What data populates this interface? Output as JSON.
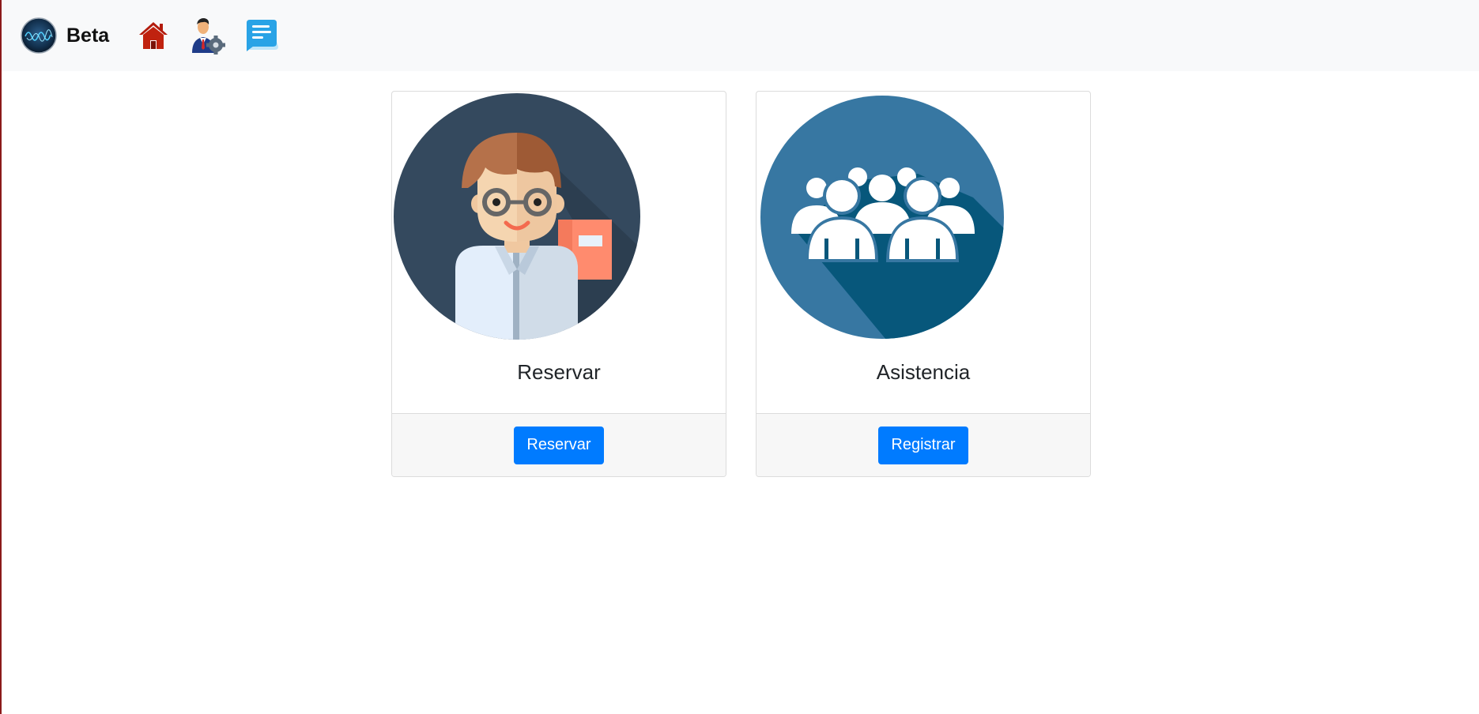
{
  "navbar": {
    "brand_name": "Beta",
    "icons": [
      "wave-logo-icon",
      "home-icon",
      "admin-settings-icon",
      "chat-icon"
    ],
    "colors": {
      "background": "#f8f9fa",
      "home": "#b31b0c",
      "chat": "#29a3e6"
    }
  },
  "cards": [
    {
      "title": "Reservar",
      "button_label": "Reservar",
      "image_icon": "student-avatar-icon"
    },
    {
      "title": "Asistencia",
      "button_label": "Registrar",
      "image_icon": "group-people-icon"
    }
  ],
  "colors": {
    "primary_button": "#007bff",
    "card_border": "#dcdcdc",
    "footer_bg": "#f7f7f7"
  }
}
